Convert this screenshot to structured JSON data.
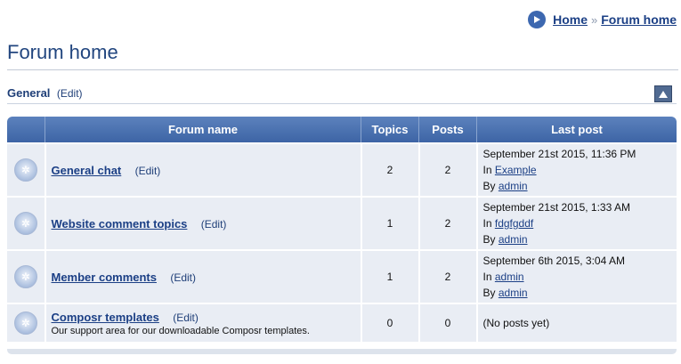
{
  "breadcrumb": {
    "items": [
      "Home",
      "Forum home"
    ],
    "separator": "»"
  },
  "page_title": "Forum home",
  "section": {
    "title": "General",
    "edit_label": "(Edit)",
    "collapse_icon": "triangle-up-icon"
  },
  "table": {
    "headers": {
      "forum_name": "Forum name",
      "topics": "Topics",
      "posts": "Posts",
      "last_post": "Last post"
    },
    "rows": [
      {
        "name": "General chat",
        "edit": "(Edit)",
        "description": "",
        "topics": "2",
        "posts": "2",
        "last_post": {
          "date": "September 21st 2015, 11:36 PM",
          "in_label": "In",
          "topic": "Example",
          "by_label": "By",
          "author": "admin"
        }
      },
      {
        "name": "Website comment topics",
        "edit": "(Edit)",
        "description": "",
        "topics": "1",
        "posts": "2",
        "last_post": {
          "date": "September 21st 2015, 1:33 AM",
          "in_label": "In",
          "topic": "fdgfgddf",
          "by_label": "By",
          "author": "admin"
        }
      },
      {
        "name": "Member comments",
        "edit": "(Edit)",
        "description": "",
        "topics": "1",
        "posts": "2",
        "last_post": {
          "date": "September 6th 2015, 3:04 AM",
          "in_label": "In",
          "topic": "admin",
          "by_label": "By",
          "author": "admin"
        }
      },
      {
        "name": "Composr templates",
        "edit": "(Edit)",
        "description": "Our support area for our downloadable Composr templates.",
        "topics": "0",
        "posts": "0",
        "last_post": {
          "none": "(No posts yet)"
        }
      }
    ]
  },
  "colors": {
    "header_bg": "#4a6fae",
    "row_bg": "#e9edf4",
    "link": "#1b3f85",
    "title": "#22467f"
  }
}
